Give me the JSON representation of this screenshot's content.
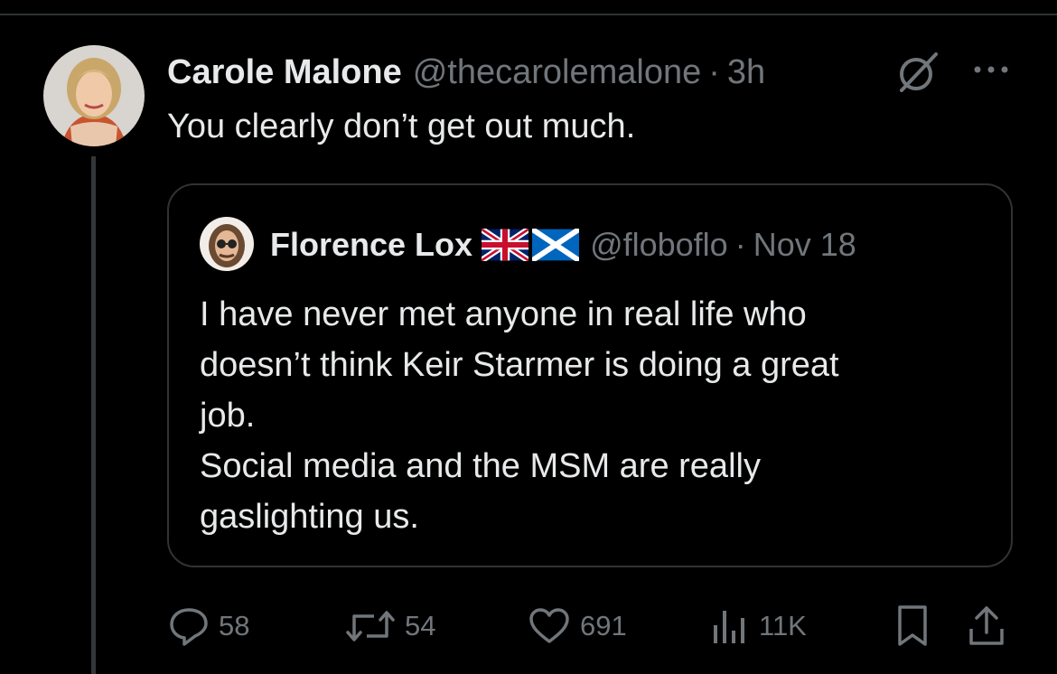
{
  "tweet": {
    "author_name": "Carole Malone",
    "author_handle": "@thecarolemalone",
    "separator": "·",
    "time": "3h",
    "text": "You clearly don’t get out much."
  },
  "quoted": {
    "author_name": "Florence Lox",
    "flags": [
      "uk-flag",
      "scotland-flag"
    ],
    "author_handle": "@floboflo",
    "separator": "·",
    "date": "Nov 18",
    "lines": [
      "I have never met anyone in real life who",
      "doesn’t think Keir Starmer is doing a great",
      "job.",
      "Social media and the MSM are really",
      "gaslighting us."
    ]
  },
  "actions": {
    "replies": "58",
    "reposts": "54",
    "likes": "691",
    "views": "11K"
  },
  "icons": [
    "grok-icon",
    "more-icon",
    "reply-icon",
    "repost-icon",
    "like-icon",
    "views-icon",
    "bookmark-icon",
    "share-icon"
  ],
  "colors": {
    "background": "#000000",
    "text": "#e7e9ea",
    "muted": "#71767b",
    "border": "#2f3336"
  }
}
